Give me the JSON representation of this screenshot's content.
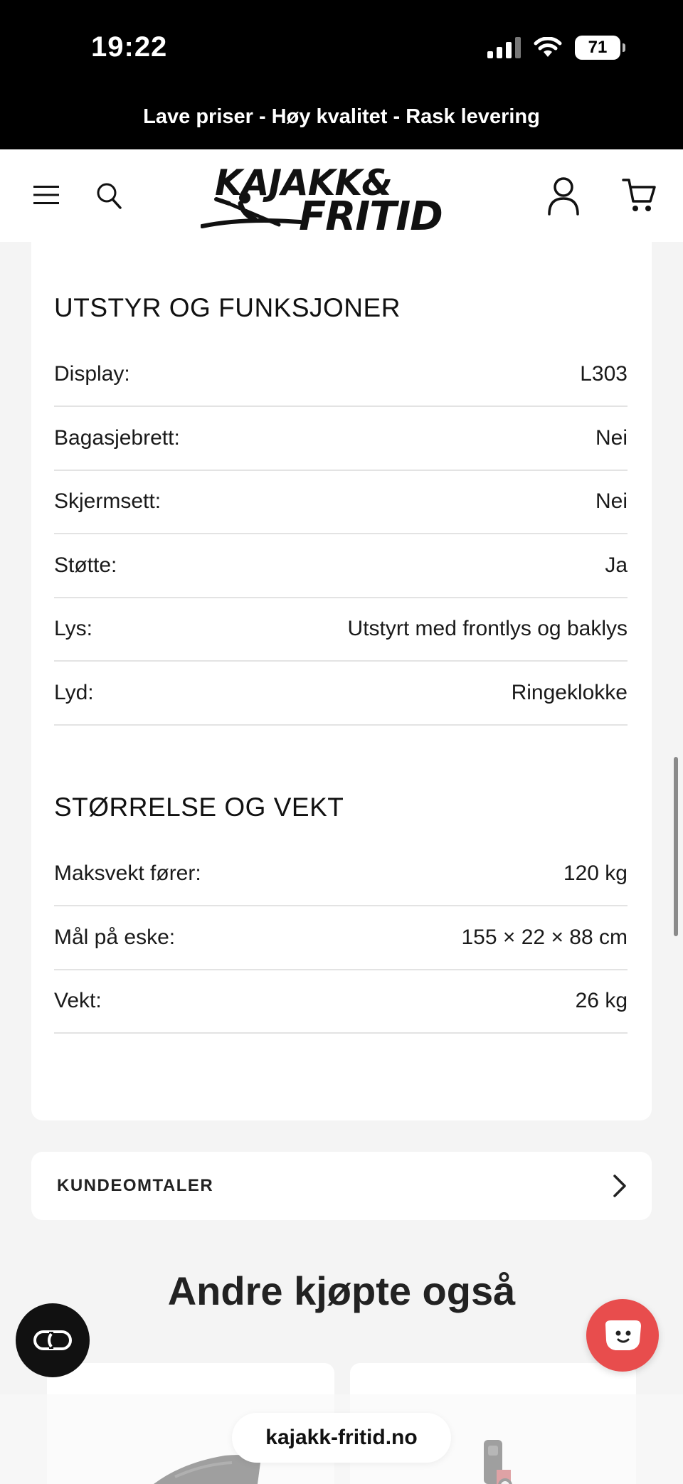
{
  "status_bar": {
    "time": "19:22",
    "battery": "71"
  },
  "promo_banner": "Lave priser - Høy kvalitet - Rask levering",
  "header": {
    "logo_line1": "KAJAKK&",
    "logo_line2": "FRITID",
    "icons": [
      "menu-icon",
      "search-icon",
      "user-icon",
      "cart-icon"
    ]
  },
  "specs": {
    "equipment": {
      "title": "UTSTYR OG FUNKSJONER",
      "rows": [
        {
          "label": "Display:",
          "value": "L303"
        },
        {
          "label": "Bagasjebrett:",
          "value": "Nei"
        },
        {
          "label": "Skjermsett:",
          "value": "Nei"
        },
        {
          "label": "Støtte:",
          "value": "Ja"
        },
        {
          "label": "Lys:",
          "value": "Utstyrt med frontlys og baklys"
        },
        {
          "label": "Lyd:",
          "value": "Ringeklokke"
        }
      ]
    },
    "size_weight": {
      "title": "STØRRELSE OG VEKT",
      "rows": [
        {
          "label": "Maksvekt fører:",
          "value": "120 kg"
        },
        {
          "label": "Mål på eske:",
          "value": "155 × 22 × 88 cm"
        },
        {
          "label": "Vekt:",
          "value": "26 kg"
        }
      ]
    }
  },
  "reviews": {
    "label": "KUNDEOMTALER"
  },
  "also_bought": {
    "title": "Andre kjøpte også"
  },
  "browser": {
    "url": "kajakk-fritid.no"
  },
  "colors": {
    "accent_red": "#e84d4d",
    "black": "#000000",
    "background": "#f4f4f4"
  }
}
